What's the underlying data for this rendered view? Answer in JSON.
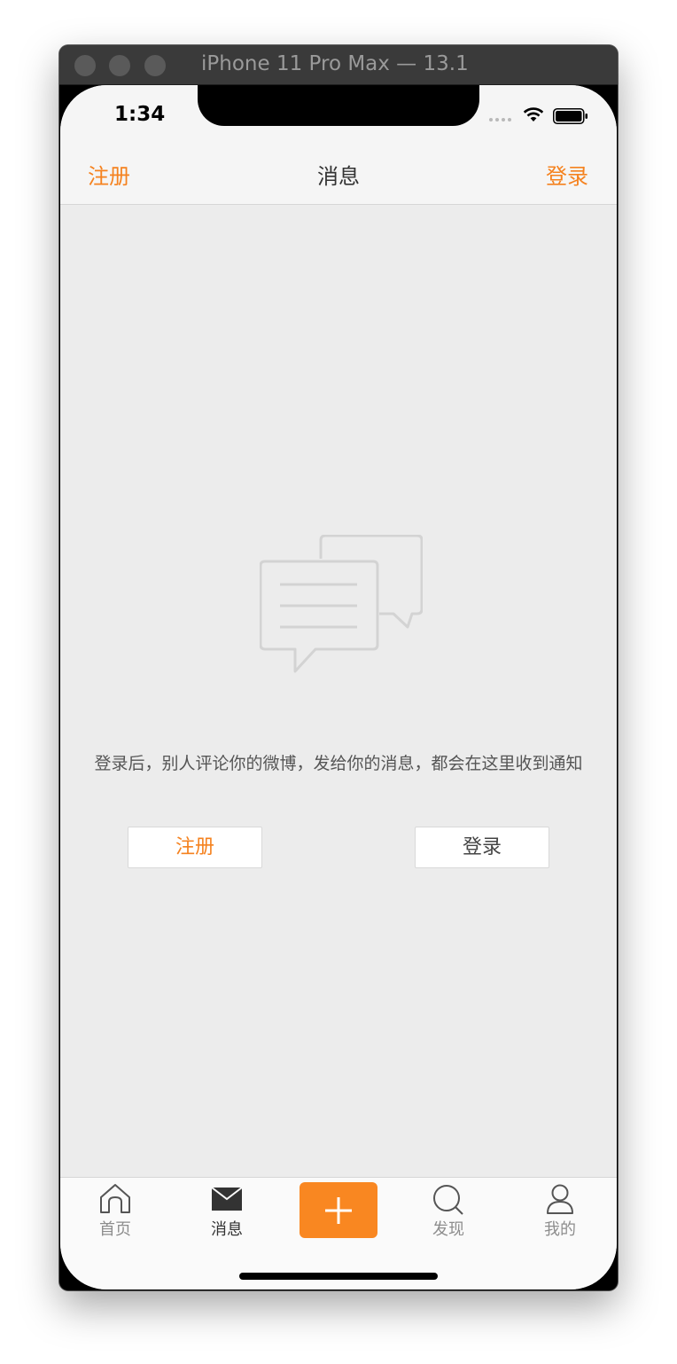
{
  "window": {
    "title": "iPhone 11 Pro Max — 13.1"
  },
  "status_bar": {
    "time": "1:34",
    "icons": [
      "cellular-dots-icon",
      "wifi-icon",
      "battery-icon"
    ]
  },
  "nav": {
    "left_label": "注册",
    "title": "消息",
    "right_label": "登录"
  },
  "empty_state": {
    "icon": "chat-bubbles-icon",
    "message": "登录后，别人评论你的微博，发给你的消息，都会在这里收到通知",
    "register_label": "注册",
    "login_label": "登录"
  },
  "tab_bar": {
    "home_label": "首页",
    "messages_label": "消息",
    "compose_icon": "plus-icon",
    "discover_label": "发现",
    "me_label": "我的",
    "active": "消息"
  },
  "colors": {
    "accent": "#f5821f",
    "compose": "#f98721",
    "background": "#ececec",
    "bar": "#f5f5f5"
  }
}
